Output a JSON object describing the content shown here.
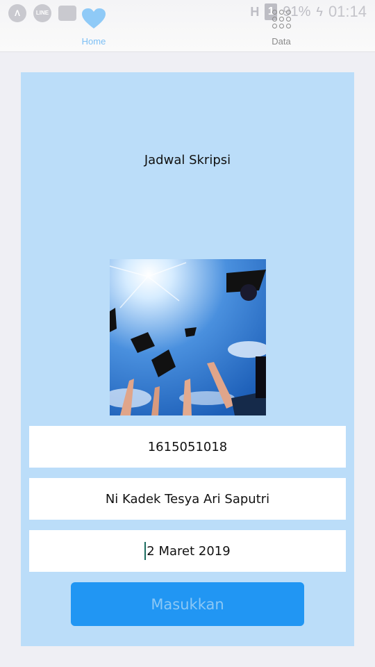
{
  "status_bar": {
    "carrier_badge": "H",
    "sim_slot": "1",
    "battery": "91%",
    "time": "01:14"
  },
  "tabs": [
    {
      "label": "Home",
      "icon": "heart-icon",
      "active": true,
      "color": "#7cbff5"
    },
    {
      "label": "Data",
      "icon": "grid-icon",
      "active": false,
      "color": "#8a8a8a"
    }
  ],
  "main": {
    "title": "Jadwal Skripsi",
    "image": "graduation-caps-photo",
    "fields": [
      {
        "value": "1615051018"
      },
      {
        "value": "Ni Kadek Tesya Ari Saputri"
      },
      {
        "value": "2 Maret 2019"
      }
    ],
    "submit_label": "Masukkan"
  },
  "colors": {
    "card_bg": "#bbddf9",
    "button_bg": "#2196f3",
    "button_text": "#8cc8f5",
    "page_bg": "#efeff4"
  }
}
